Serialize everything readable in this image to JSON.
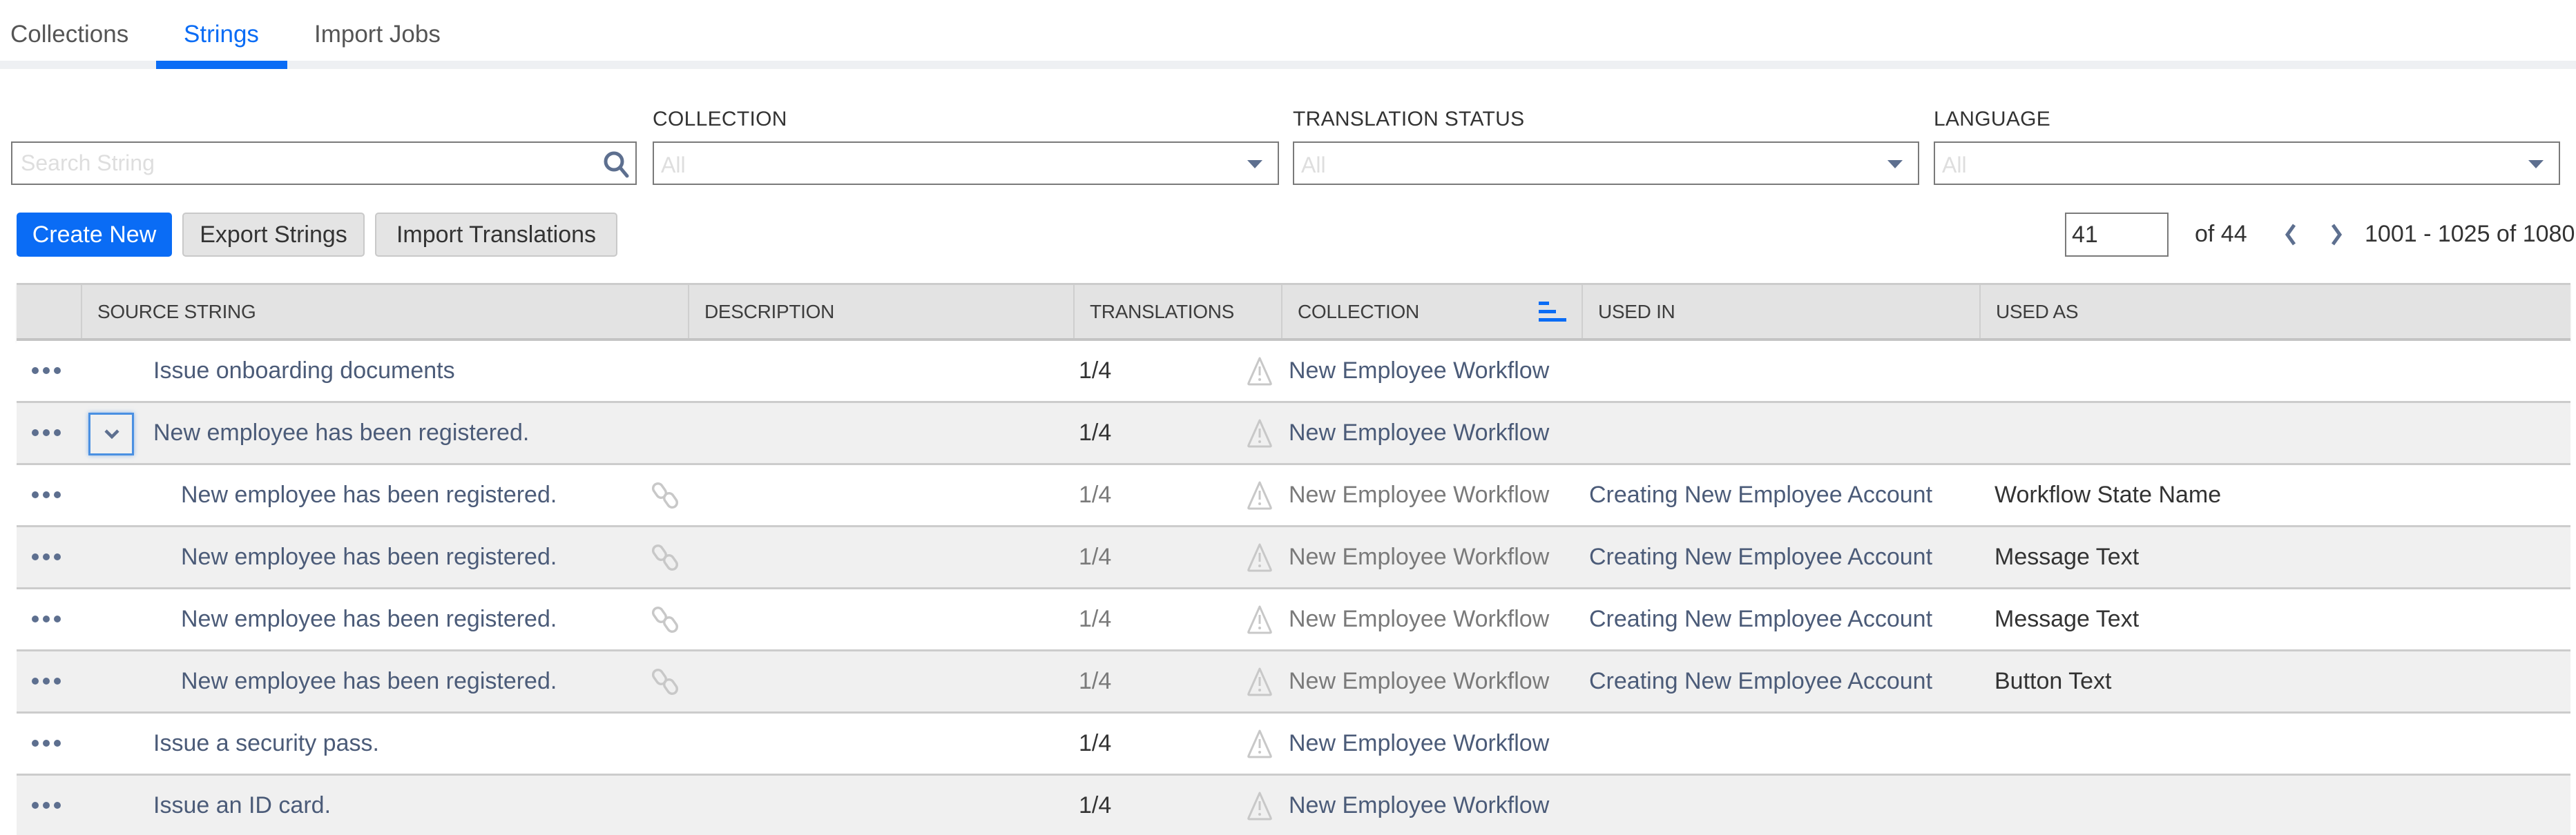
{
  "tabs": [
    {
      "label": "Collections",
      "active": false
    },
    {
      "label": "Strings",
      "active": true
    },
    {
      "label": "Import Jobs",
      "active": false
    }
  ],
  "filters": {
    "search": {
      "placeholder": "Search String",
      "value": ""
    },
    "collection": {
      "label": "COLLECTION",
      "value": "All"
    },
    "translation_status": {
      "label": "TRANSLATION STATUS",
      "value": "All"
    },
    "language": {
      "label": "LANGUAGE",
      "value": "All"
    }
  },
  "toolbar": {
    "create_label": "Create New",
    "export_label": "Export Strings",
    "import_label": "Import Translations"
  },
  "pagination": {
    "current_page": "41",
    "of_pages": "of 44",
    "range": "1001 - 1025 of 1080"
  },
  "table": {
    "headers": {
      "source": "SOURCE STRING",
      "description": "DESCRIPTION",
      "translations": "TRANSLATIONS",
      "collection": "COLLECTION",
      "used_in": "USED IN",
      "used_as": "USED AS"
    },
    "sorted_column": "COLLECTION",
    "sort_direction": "ascending",
    "rows": [
      {
        "source": "Issue onboarding documents",
        "description": "",
        "translations": "1/4",
        "collection": "New Employee Workflow",
        "used_in": "",
        "used_as": "",
        "level": "parent",
        "expandable": false
      },
      {
        "source": "New employee has been registered.",
        "description": "",
        "translations": "1/4",
        "collection": "New Employee Workflow",
        "used_in": "",
        "used_as": "",
        "level": "parent",
        "expandable": true,
        "expanded": true
      },
      {
        "source": "New employee has been registered.",
        "description": "",
        "translations": "1/4",
        "collection": "New Employee Workflow",
        "used_in": "Creating New Employee Account",
        "used_as": "Workflow State Name",
        "level": "child",
        "linked": true
      },
      {
        "source": "New employee has been registered.",
        "description": "",
        "translations": "1/4",
        "collection": "New Employee Workflow",
        "used_in": "Creating New Employee Account",
        "used_as": "Message Text",
        "level": "child",
        "linked": true
      },
      {
        "source": "New employee has been registered.",
        "description": "",
        "translations": "1/4",
        "collection": "New Employee Workflow",
        "used_in": "Creating New Employee Account",
        "used_as": "Message Text",
        "level": "child",
        "linked": true
      },
      {
        "source": "New employee has been registered.",
        "description": "",
        "translations": "1/4",
        "collection": "New Employee Workflow",
        "used_in": "Creating New Employee Account",
        "used_as": "Button Text",
        "level": "child",
        "linked": true
      },
      {
        "source": "Issue a security pass.",
        "description": "",
        "translations": "1/4",
        "collection": "New Employee Workflow",
        "used_in": "",
        "used_as": "",
        "level": "parent",
        "expandable": false
      },
      {
        "source": "Issue an ID card.",
        "description": "",
        "translations": "1/4",
        "collection": "New Employee Workflow",
        "used_in": "",
        "used_as": "",
        "level": "parent",
        "expandable": false
      }
    ]
  },
  "colors": {
    "accent": "#0a6cf5",
    "link_text": "#4b5b78",
    "header_bg": "#e3e3e3",
    "row_alt_bg": "#f0f0f0"
  }
}
